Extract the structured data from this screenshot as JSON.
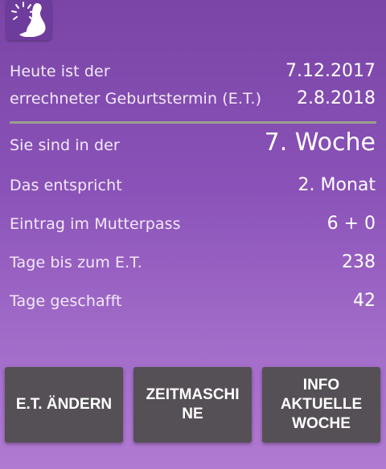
{
  "icon": "pregnancy-clock-icon",
  "colors": {
    "background_top": "#7a45a6",
    "background_bottom": "#b07ad2",
    "button_bg": "#555055",
    "divider": "#9a9f8c"
  },
  "info": {
    "today_label": "Heute ist der",
    "today_value": "7.12.2017",
    "due_label": "errechneter Geburtstermin (E.T.)",
    "due_value": "2.8.2018"
  },
  "stats": {
    "week_label": "Sie sind in der",
    "week_value": "7. Woche",
    "month_label": "Das entspricht",
    "month_value": "2. Monat",
    "passport_label": "Eintrag im Mutterpass",
    "passport_value": "6 + 0",
    "days_left_label": "Tage bis zum E.T.",
    "days_left_value": "238",
    "days_done_label": "Tage geschafft",
    "days_done_value": "42"
  },
  "buttons": {
    "change_due": "E.T. ÄNDERN",
    "time_machine": "ZEITMASCHI\nNE",
    "info_week": "INFO\nAKTUELLE\nWOCHE"
  }
}
